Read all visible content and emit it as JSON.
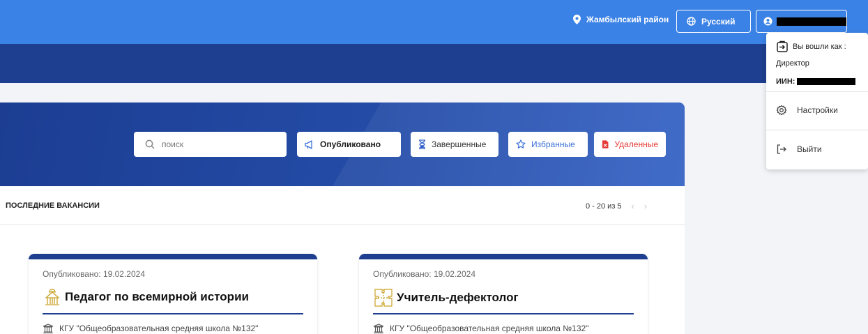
{
  "topbar": {
    "location": "Жамбылский район",
    "language": "Русский",
    "bg_color": "#3b82e6"
  },
  "navband": {
    "bg_color": "#1e3f8f"
  },
  "filters": {
    "search_placeholder": "поиск",
    "published": "Опубликовано",
    "completed": "Завершенные",
    "favorites": "Избранные",
    "deleted": "Удаленные"
  },
  "panel": {
    "title": "ПОСЛЕДНИЕ ВАКАНСИИ",
    "pagination": "0 - 20 из 5",
    "prev": "‹",
    "next": "›"
  },
  "cards": [
    {
      "published": "Опубликовано: 19.02.2024",
      "title": "Педагог по всемирной истории",
      "org": "КГУ \"Общеобразовательная средняя школа №132\""
    },
    {
      "published": "Опубликовано: 19.02.2024",
      "title": "Учитель-дефектолог",
      "org": "КГУ \"Общеобразовательная средняя школа №132\""
    }
  ],
  "user_menu": {
    "logged_in_as": "Вы вошли как :",
    "role": "Директор",
    "iin_label": "ИИН:",
    "settings": "Настройки",
    "logout": "Выйти"
  }
}
